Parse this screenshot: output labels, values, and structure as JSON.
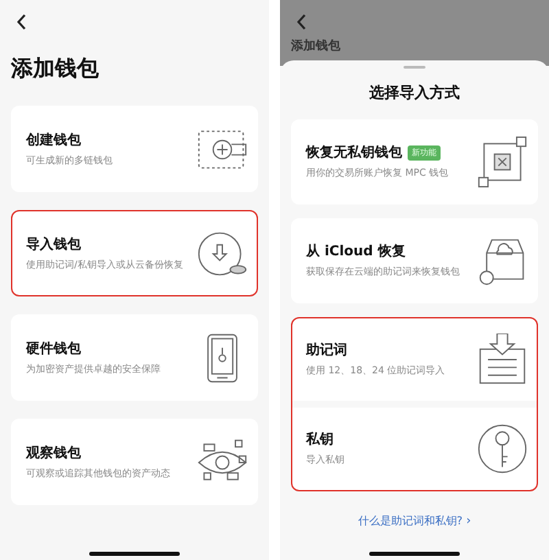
{
  "left": {
    "title": "添加钱包",
    "cards": [
      {
        "title": "创建钱包",
        "subtitle": "可生成新的多链钱包",
        "highlighted": false,
        "kind": "create"
      },
      {
        "title": "导入钱包",
        "subtitle": "使用助记词/私钥导入或从云备份恢复",
        "highlighted": true,
        "kind": "import"
      },
      {
        "title": "硬件钱包",
        "subtitle": "为加密资产提供卓越的安全保障",
        "highlighted": false,
        "kind": "hardware"
      },
      {
        "title": "观察钱包",
        "subtitle": "可观察或追踪其他钱包的资产动态",
        "highlighted": false,
        "kind": "watch"
      }
    ]
  },
  "right": {
    "backdrop_title": "添加钱包",
    "sheet": {
      "title": "选择导入方式",
      "cards": [
        {
          "highlighted": false,
          "rows": [
            {
              "title": "恢复无私钥钱包",
              "badge": "新功能",
              "subtitle": "用你的交易所账户恢复 MPC 钱包",
              "kind": "mpc"
            }
          ]
        },
        {
          "highlighted": false,
          "rows": [
            {
              "title": "从 iCloud 恢复",
              "subtitle": "获取保存在云端的助记词来恢复钱包",
              "kind": "cloud"
            }
          ]
        },
        {
          "highlighted": true,
          "rows": [
            {
              "title": "助记词",
              "subtitle": "使用 12、18、24 位助记词导入",
              "kind": "mnemonic"
            },
            {
              "title": "私钥",
              "subtitle": "导入私钥",
              "kind": "key"
            }
          ]
        }
      ],
      "link": "什么是助记词和私钥?",
      "link_arrow": "›"
    }
  }
}
